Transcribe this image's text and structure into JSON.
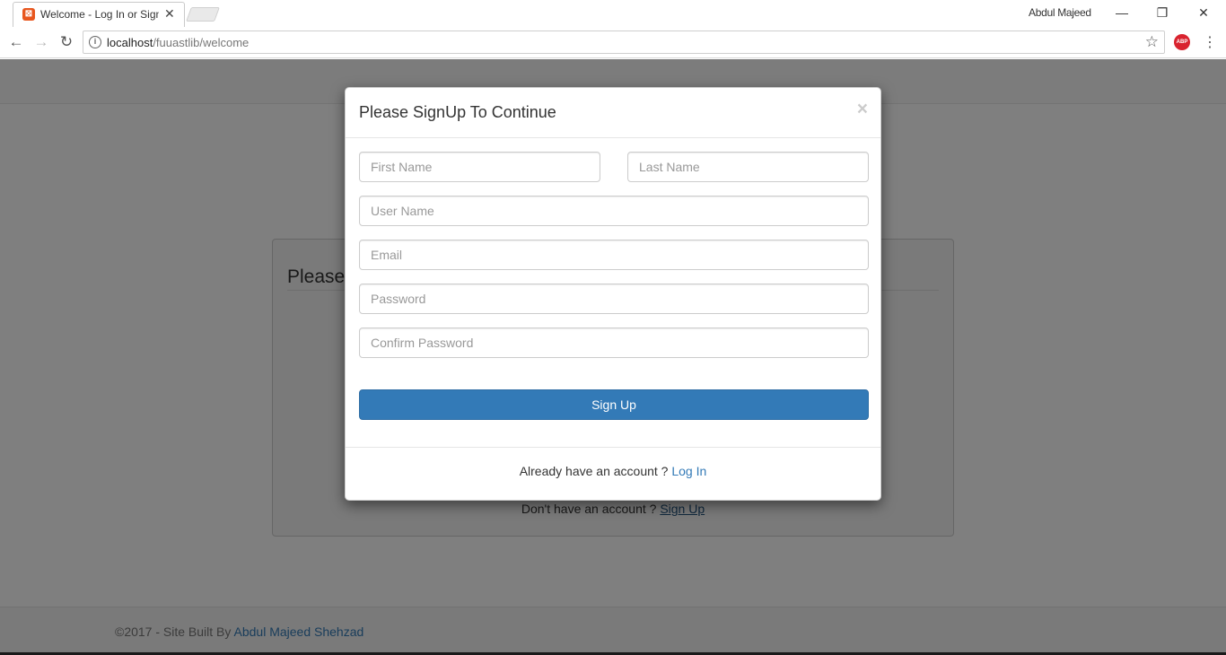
{
  "browser": {
    "tab_title": "Welcome - Log In or Sign Up",
    "tab_close": "✕",
    "favicon": "⊠",
    "profile_name": "Abdul Majeed",
    "minimize": "—",
    "restore": "❐",
    "close": "✕",
    "back": "←",
    "forward": "→",
    "reload": "↻",
    "info": "i",
    "url_host": "localhost",
    "url_path": "/fuuastlib/welcome",
    "bookmark_star": "☆",
    "abp_label": "ABP",
    "menu": "⋮"
  },
  "background_page": {
    "login_heading": "Please",
    "signup_prompt": "Don't have an account ?",
    "signup_link": "Sign Up",
    "footer_prefix": "©2017 - Site Built By",
    "footer_author": "Abdul Majeed Shehzad"
  },
  "modal": {
    "title": "Please SignUp To Continue",
    "close": "×",
    "fields": {
      "first_name": "First Name",
      "last_name": "Last Name",
      "user_name": "User Name",
      "email": "Email",
      "password": "Password",
      "confirm_password": "Confirm Password"
    },
    "submit_label": "Sign Up",
    "footer_prompt": "Already have an account ?",
    "footer_link": "Log In"
  },
  "colors": {
    "primary": "#337ab7",
    "abp_red": "#d9232f",
    "favicon_orange": "#e8561e"
  }
}
